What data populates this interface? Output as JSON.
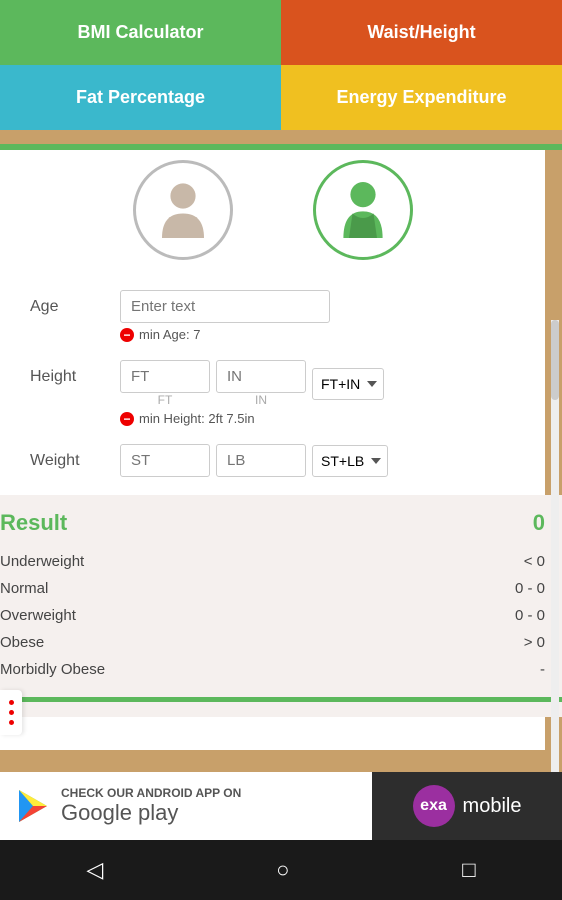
{
  "header": {
    "bmi_label": "BMI Calculator",
    "waist_label": "Waist/Height",
    "fat_label": "Fat Percentage",
    "energy_label": "Energy Expenditure"
  },
  "form": {
    "age_label": "Age",
    "height_label": "Height",
    "weight_label": "Weight",
    "age_placeholder": "Enter text",
    "age_validation": "min Age: 7",
    "height_ft_placeholder": "FT",
    "height_in_placeholder": "IN",
    "height_unit": "FT+IN",
    "height_validation": "min Height: 2ft 7.5in",
    "weight_st_placeholder": "ST",
    "weight_lb_placeholder": "LB",
    "weight_unit": "ST+LB"
  },
  "result": {
    "label": "Result",
    "value": "0",
    "rows": [
      {
        "category": "Underweight",
        "range": "< 0"
      },
      {
        "category": "Normal",
        "range": "0 - 0"
      },
      {
        "category": "Overweight",
        "range": "0 - 0"
      },
      {
        "category": "Obese",
        "range": "> 0"
      },
      {
        "category": "Morbidly Obese",
        "range": "-"
      }
    ]
  },
  "banner": {
    "check_text": "CHECK OUR ANDROID APP ON",
    "google_play_text": "Google play",
    "exa_text": "exa",
    "mobile_text": "mobile"
  },
  "nav": {
    "back_icon": "◁",
    "home_icon": "○",
    "recent_icon": "□"
  },
  "colors": {
    "green": "#5cb85c",
    "orange_red": "#d9531e",
    "teal": "#3ab8cc",
    "yellow": "#f0c020",
    "wood": "#c8a06a"
  }
}
